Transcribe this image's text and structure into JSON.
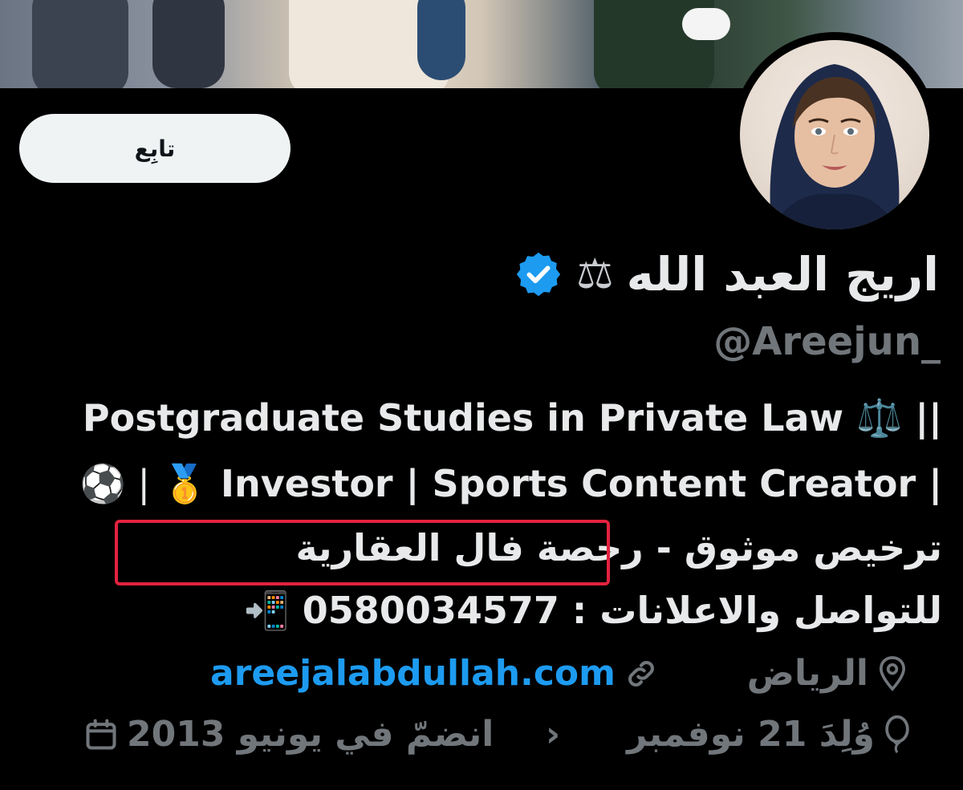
{
  "profile": {
    "display_name": "اريج العبد الله",
    "handle": "@Areejun_",
    "follow_label": "تابِع",
    "bio": {
      "line1": "Postgraduate Studies in Private Law ⚖️ ||",
      "line2_text": "Investor | Sports Content Creator |",
      "line2_prefix": "⚽️ | 🥇",
      "line3": "ترخيص موثوق - رخصة فال العقارية",
      "line4": "للتواصل والاعلانات : 0580034577 📲"
    },
    "location": "الرياض",
    "website": "areejalabdullah.com",
    "birthday": "وُلِدَ 21 نوفمبر",
    "joined": "انضمّ في يونيو 2013",
    "chevron": "›"
  },
  "icons": {
    "scales": "scales-icon",
    "verified": "verified-badge-icon",
    "location": "location-pin-icon",
    "link": "link-icon",
    "birthday": "balloon-icon",
    "calendar": "calendar-icon"
  },
  "colors": {
    "background": "#000000",
    "primary_text": "#e7e9ea",
    "secondary_text": "#71767b",
    "link": "#1d9bf0",
    "verified": "#1d9bf0",
    "follow_button_bg": "#eff3f4",
    "highlight": "#e3223f"
  }
}
